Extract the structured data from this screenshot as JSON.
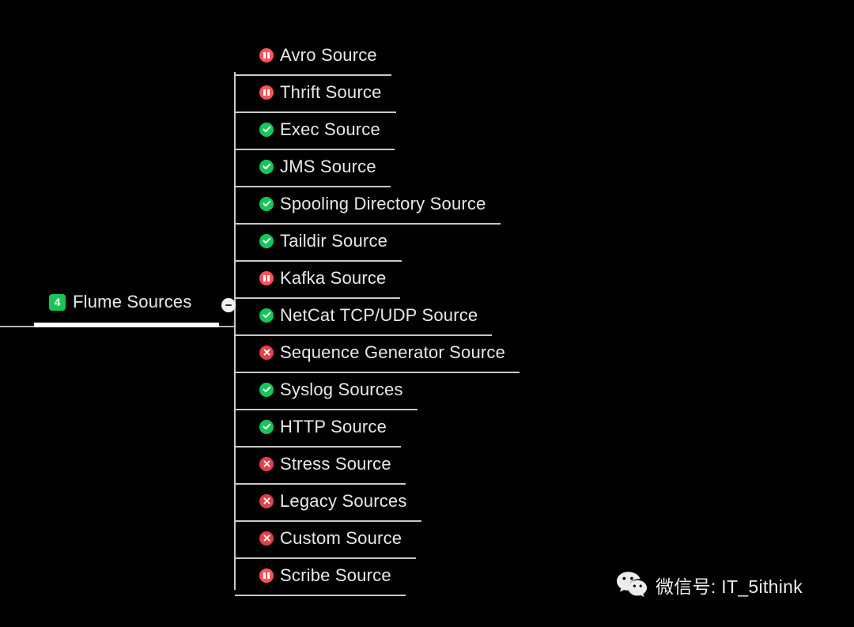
{
  "canvas": {
    "background": "#000000",
    "text_color": "#e9e9e9",
    "line_color": "#c9c9c9"
  },
  "root": {
    "label": "Flume Sources",
    "badge_count": "4",
    "badge_color": "#16c65a",
    "collapse_icon": "minus-circle-icon",
    "expanded": true
  },
  "legend": {
    "check": {
      "icon": "check-circle-icon",
      "color": "#16c65a"
    },
    "pause": {
      "icon": "pause-circle-icon",
      "color": "#f8565a"
    },
    "cross": {
      "icon": "cross-circle-icon",
      "color": "#e0414a"
    }
  },
  "children": [
    {
      "label": "Avro Source",
      "status": "pause"
    },
    {
      "label": "Thrift Source",
      "status": "pause"
    },
    {
      "label": "Exec Source",
      "status": "check"
    },
    {
      "label": "JMS Source",
      "status": "check"
    },
    {
      "label": "Spooling Directory Source",
      "status": "check"
    },
    {
      "label": "Taildir Source",
      "status": "check"
    },
    {
      "label": "Kafka Source",
      "status": "pause"
    },
    {
      "label": "NetCat TCP/UDP Source",
      "status": "check"
    },
    {
      "label": "Sequence Generator Source",
      "status": "cross"
    },
    {
      "label": "Syslog Sources",
      "status": "check"
    },
    {
      "label": "HTTP Source",
      "status": "check"
    },
    {
      "label": "Stress Source",
      "status": "cross"
    },
    {
      "label": "Legacy Sources",
      "status": "cross"
    },
    {
      "label": "Custom Source",
      "status": "cross"
    },
    {
      "label": "Scribe Source",
      "status": "pause"
    }
  ],
  "watermark": {
    "icon": "wechat-logo-icon",
    "text": "微信号: IT_5ithink"
  }
}
